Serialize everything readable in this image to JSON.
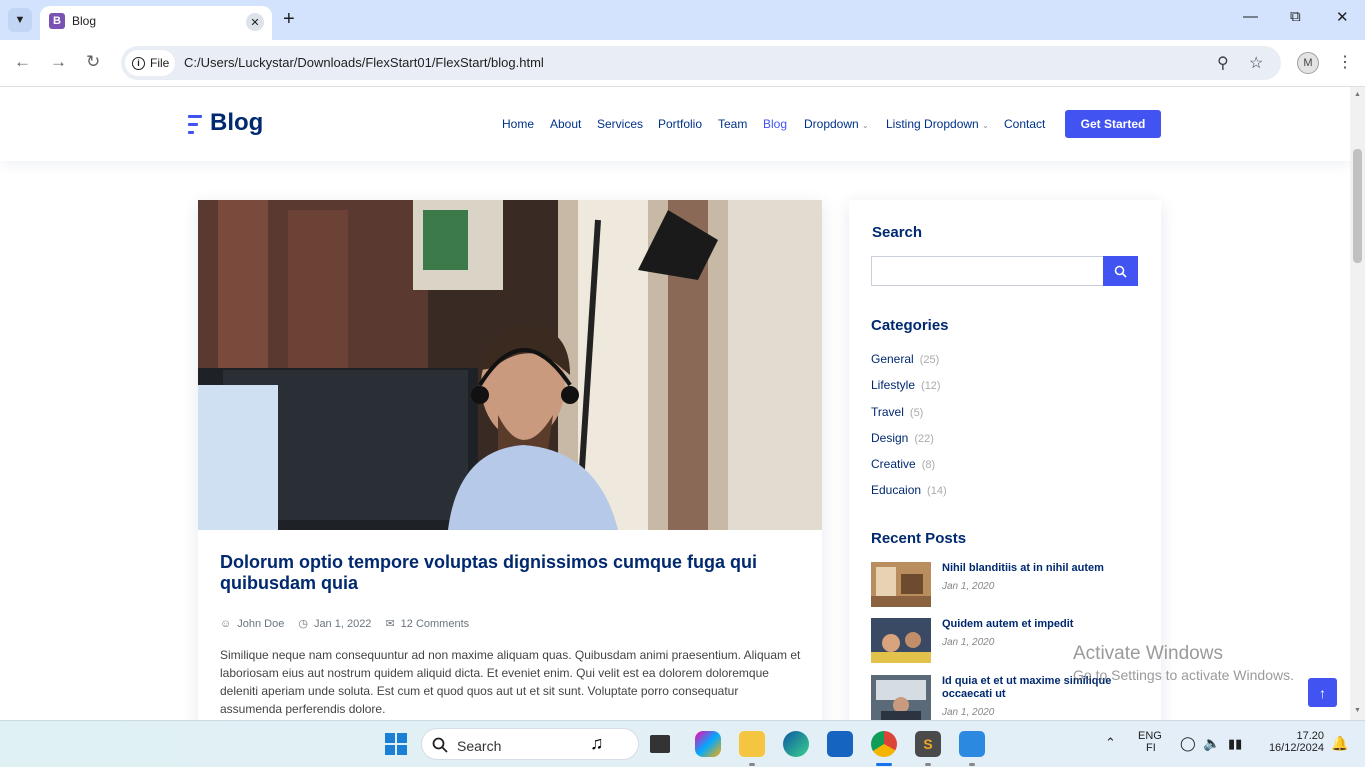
{
  "browser": {
    "tab_title": "Blog",
    "tab_favicon": "B",
    "url_chip": "File",
    "url": "C:/Users/Luckystar/Downloads/FlexStart01/FlexStart/blog.html",
    "profile_initial": "M"
  },
  "site": {
    "logo": "Blog",
    "menu": [
      "Home",
      "About",
      "Services",
      "Portfolio",
      "Team",
      "Blog",
      "Dropdown",
      "Listing Dropdown",
      "Contact"
    ],
    "active_menu": "Blog",
    "cta": "Get Started"
  },
  "post": {
    "title": "Dolorum optio tempore voluptas dignissimos cumque fuga qui quibusdam quia",
    "author": "John Doe",
    "date": "Jan 1, 2022",
    "comments": "12 Comments",
    "excerpt": "Similique neque nam consequuntur ad non maxime aliquam quas. Quibusdam animi praesentium. Aliquam et laboriosam eius aut nostrum quidem aliquid dicta. Et eveniet enim. Qui velit est ea dolorem doloremque deleniti aperiam unde soluta. Est cum et quod quos aut ut et sit sunt. Voluptate porro consequatur assumenda perferendis dolore."
  },
  "sidebar": {
    "search_heading": "Search",
    "search_value": "",
    "categories_heading": "Categories",
    "categories": [
      {
        "name": "General",
        "count": "(25)"
      },
      {
        "name": "Lifestyle",
        "count": "(12)"
      },
      {
        "name": "Travel",
        "count": "(5)"
      },
      {
        "name": "Design",
        "count": "(22)"
      },
      {
        "name": "Creative",
        "count": "(8)"
      },
      {
        "name": "Educaion",
        "count": "(14)"
      }
    ],
    "recent_heading": "Recent Posts",
    "recent": [
      {
        "title": "Nihil blanditiis at in nihil autem",
        "date": "Jan 1, 2020"
      },
      {
        "title": "Quidem autem et impedit",
        "date": "Jan 1, 2020"
      },
      {
        "title": "Id quia et et ut maxime similique occaecati ut",
        "date": "Jan 1, 2020"
      }
    ]
  },
  "watermark": {
    "line1": "Activate Windows",
    "line2": "Go to Settings to activate Windows."
  },
  "taskbar": {
    "search_label": "Search",
    "lang": "ENG",
    "region": "FI",
    "time": "17.20",
    "date": "16/12/2024"
  },
  "colors": {
    "accent": "#4154f1",
    "navy": "#012970",
    "chrome_bg": "#d3e3fd"
  }
}
